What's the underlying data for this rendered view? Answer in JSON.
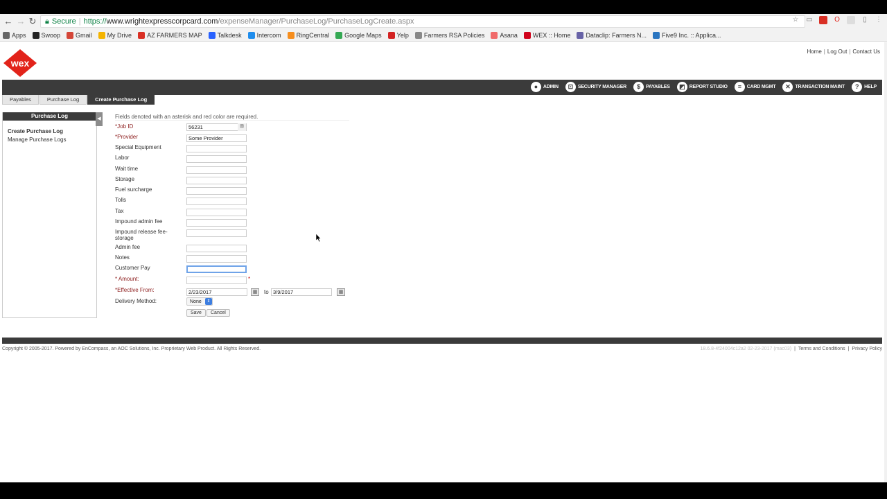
{
  "browser": {
    "secure_label": "Secure",
    "url_scheme": "https://",
    "url_host": "www.wrightexpresscorpcard.com",
    "url_path": "/expenseManager/PurchaseLog/PurchaseLogCreate.aspx"
  },
  "bookmarks": [
    {
      "label": "Apps",
      "color": "#666"
    },
    {
      "label": "Swoop",
      "color": "#222"
    },
    {
      "label": "Gmail",
      "color": "#d44638"
    },
    {
      "label": "My Drive",
      "color": "#f4b400"
    },
    {
      "label": "AZ FARMERS MAP",
      "color": "#d93025"
    },
    {
      "label": "Talkdesk",
      "color": "#2962ff"
    },
    {
      "label": "Intercom",
      "color": "#1f8ded"
    },
    {
      "label": "RingCentral",
      "color": "#f68e1e"
    },
    {
      "label": "Google Maps",
      "color": "#34a853"
    },
    {
      "label": "Yelp",
      "color": "#d32323"
    },
    {
      "label": "Farmers RSA Policies",
      "color": "#888"
    },
    {
      "label": "Asana",
      "color": "#f06a6a"
    },
    {
      "label": "WEX :: Home",
      "color": "#d0021b"
    },
    {
      "label": "Dataclip: Farmers N...",
      "color": "#6762a6"
    },
    {
      "label": "Five9 Inc. :: Applica...",
      "color": "#2a75c0"
    }
  ],
  "header": {
    "logo_text": "wex",
    "brand_color": "#e2231a",
    "links": [
      "Home",
      "Log Out",
      "Contact Us"
    ]
  },
  "nav": [
    {
      "label": "ADMIN",
      "icon": "person-icon"
    },
    {
      "label": "SECURITY MANAGER",
      "icon": "lock-icon"
    },
    {
      "label": "PAYABLES",
      "icon": "dollar-icon"
    },
    {
      "label": "REPORT STUDIO",
      "icon": "chart-icon"
    },
    {
      "label": "CARD MGMT",
      "icon": "card-icon"
    },
    {
      "label": "TRANSACTION MAINT",
      "icon": "tools-icon"
    },
    {
      "label": "HELP",
      "icon": "question-icon"
    }
  ],
  "breadcrumbs": [
    "Payables",
    "Purchase Log",
    "Create Purchase Log"
  ],
  "sidebar": {
    "title": "Purchase Log",
    "links": [
      "Create Purchase Log",
      "Manage Purchase Logs"
    ]
  },
  "form": {
    "note": "Fields denoted with an asterisk and red color are required.",
    "job_id_label": "*Job ID",
    "job_id_value": "56231",
    "provider_label": "*Provider",
    "provider_value": "Some Provider",
    "fields": [
      "Special Equipment",
      "Labor",
      "Wait time",
      "Storage",
      "Fuel surcharge",
      "Tolls",
      "Tax",
      "Impound admin fee",
      "Impound release fee-storage",
      "Admin fee",
      "Notes",
      "Customer Pay"
    ],
    "amount_label": "* Amount:",
    "amount_value": "",
    "effective_label": "*Effective From:",
    "date_from": "2/23/2017",
    "to_label": "to",
    "date_to": "3/9/2017",
    "delivery_label": "Delivery Method:",
    "delivery_value": "None",
    "save_label": "Save",
    "cancel_label": "Cancel"
  },
  "footer": {
    "copyright": "Copyright © 2005-2017. Powered by EnCompass, an AOC Solutions, Inc. Proprietary Web Product. All Rights Reserved.",
    "version": "18.6.8-4f24004c12a2  02-23-2017  (mac03)",
    "terms": "Terms and Conditions",
    "privacy": "Privacy Policy"
  }
}
